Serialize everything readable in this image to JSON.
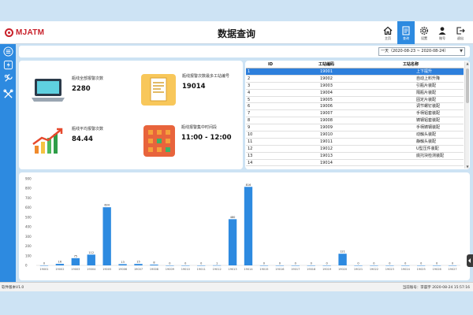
{
  "app": {
    "logo_text": "MJATM",
    "page_title": "数据查询"
  },
  "topnav": [
    {
      "label": "主页",
      "icon": "home-icon",
      "active": false
    },
    {
      "label": "查询",
      "icon": "query-icon",
      "active": true
    },
    {
      "label": "设置",
      "icon": "settings-icon",
      "active": false
    },
    {
      "label": "账号",
      "icon": "account-icon",
      "active": false
    },
    {
      "label": "退出",
      "icon": "logout-icon",
      "active": false
    }
  ],
  "sidebar": [
    "list-icon",
    "power-icon",
    "tools-icon",
    "wrench-cross-icon"
  ],
  "date_range": "一天（2020-08-23 ~ 2020-08-24）",
  "stats": [
    {
      "label": "瓶线全部报警次数",
      "value": "2280",
      "icon": "laptop-icon"
    },
    {
      "label": "瓶线报警次数最多工站编号",
      "value": "19014",
      "icon": "document-icon"
    },
    {
      "label": "瓶线平均报警次数",
      "value": "84.44",
      "icon": "growth-chart-icon"
    },
    {
      "label": "瓶线报警集中时间段",
      "value": "11:00 - 12:00",
      "icon": "calendar-icon"
    }
  ],
  "table": {
    "headers": [
      "ID",
      "工站编码",
      "工站名称"
    ],
    "selected_row": 0,
    "rows": [
      [
        "1",
        "19001",
        "上下提升"
      ],
      [
        "2",
        "19002",
        "自动上料升降"
      ],
      [
        "3",
        "19003",
        "引瓶片装配"
      ],
      [
        "4",
        "19004",
        "隔瓶片装配"
      ],
      [
        "5",
        "19005",
        "固定片装配"
      ],
      [
        "6",
        "19006",
        "调节螺钉装配"
      ],
      [
        "7",
        "19007",
        "手柄铝套装配"
      ],
      [
        "8",
        "19008",
        "铸钢铝套装配"
      ],
      [
        "9",
        "19009",
        "手柄铸钢装配"
      ],
      [
        "10",
        "19010",
        "动触头装配"
      ],
      [
        "11",
        "19011",
        "静触头装配"
      ],
      [
        "12",
        "19012",
        "U型压件装配"
      ],
      [
        "13",
        "19013",
        "底托块检测装配"
      ],
      [
        "14",
        "19014",
        ""
      ]
    ]
  },
  "chart_data": {
    "type": "bar",
    "categories": [
      "19001",
      "19002",
      "19003",
      "19004",
      "19005",
      "19006",
      "19007",
      "19008",
      "19009",
      "19010",
      "19011",
      "19012",
      "19013",
      "19014",
      "19015",
      "19016",
      "19017",
      "19018",
      "19019",
      "19020",
      "19021",
      "19022",
      "19023",
      "19024",
      "19025",
      "19026",
      "19027"
    ],
    "values": [
      0,
      16,
      75,
      112,
      604,
      13,
      15,
      8,
      0,
      0,
      0,
      1,
      480,
      816,
      0,
      0,
      0,
      0,
      0,
      121,
      0,
      0,
      0,
      0,
      0,
      0,
      0
    ],
    "ylim": [
      0,
      900
    ],
    "yticks": [
      "0",
      "100",
      "200",
      "300",
      "400",
      "500",
      "600",
      "700",
      "800",
      "900"
    ],
    "color": "#2d8ae0",
    "grid": false
  },
  "status": {
    "left": "软件版本V1.0",
    "right": "当前账号：李晨宇 2020-08-24 15:57:16"
  },
  "colors": {
    "accent": "#2d8ae0",
    "background": "#cde3f4",
    "brand": "#c8202a"
  }
}
